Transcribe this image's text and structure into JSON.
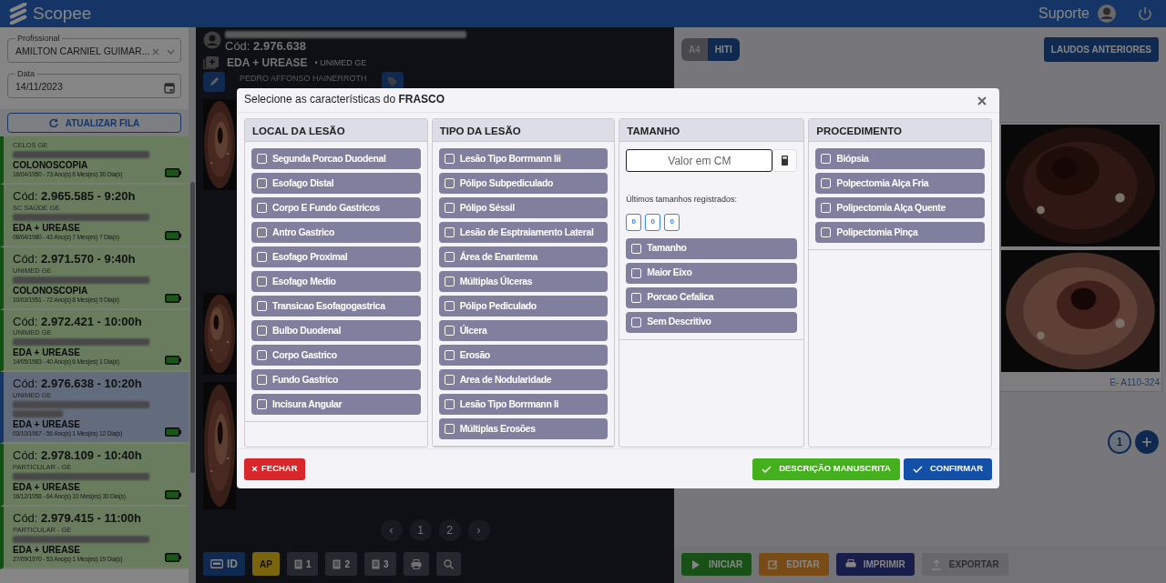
{
  "app": {
    "brand": "Scopee",
    "support": "Suporte"
  },
  "filters": {
    "professional": {
      "label": "Profissional",
      "value": "AMILTON CARNIEL GUIMAR..."
    },
    "date": {
      "label": "Data",
      "value": "14/11/2023"
    }
  },
  "refresh_button": "ATUALIZAR FILA",
  "queue": [
    {
      "insurer": "CELOS GE",
      "exam": "COLONOSCOPIA",
      "birth": "16/04/1950 - 73 Ano(s) 6 Mes(es) 30 Dia(s)",
      "selected": false,
      "long_name": false
    },
    {
      "code": "Cód: **2.965.585 - 9:20h**",
      "insurer": "SC SAÚDE GE",
      "exam": "EDA + UREASE",
      "birth": "08/04/1980 - 43 Ano(s) 7 Mes(es) 7 Dia(s)",
      "selected": false,
      "long_name": false
    },
    {
      "code": "Cód: **2.971.570 - 9:40h**",
      "insurer": "UNIMED GE",
      "exam": "COLONOSCOPIA",
      "birth": "10/03/1951 - 72 Ano(s) 8 Mes(es) 5 Dia(s)",
      "selected": false,
      "long_name": false
    },
    {
      "code": "Cód: **2.972.421 - 10:00h**",
      "insurer": "UNIMED GE",
      "exam": "EDA + UREASE",
      "birth": "14/05/1983 - 40 Ano(s) 6 Mes(es) 1 Dia(s)",
      "selected": false,
      "long_name": false
    },
    {
      "code": "Cód: **2.976.638 - 10:20h**",
      "insurer": "UNIMED GE",
      "exam": "EDA + UREASE",
      "birth": "03/10/1967 - 56 Ano(s) 1 Mes(es) 12 Dia(s)",
      "selected": true,
      "long_name": true
    },
    {
      "code": "Cód: **2.978.109 - 10:40h**",
      "insurer": "PARTICULAR - GE",
      "exam": "EDA + UREASE",
      "birth": "16/12/1958 - 64 Ano(s) 10 Mes(es) 30 Dia(s)",
      "selected": false,
      "long_name": false
    },
    {
      "code": "Cód: **2.979.415 - 11:00h**",
      "insurer": "PARTICULAR - GE",
      "exam": "EDA + UREASE",
      "birth": "27/09/1970 - 53 Ano(s) 1 Mes(es) 19 Dia(s)",
      "selected": false,
      "long_name": false
    }
  ],
  "patient": {
    "code": "Cód: **2.976.638**",
    "exam": "EDA + UREASE",
    "insurer": "• UNIMED GE",
    "doctor": "PEDRO AFFONSO HAINERROTH"
  },
  "pagination": {
    "prev": "‹",
    "pages": [
      "1",
      "2"
    ],
    "next": "›"
  },
  "toolbar": [
    {
      "kind": "id",
      "label": "ID"
    },
    {
      "kind": "ap",
      "label": "AP"
    },
    {
      "kind": "doc",
      "label": "1"
    },
    {
      "kind": "doc",
      "label": "2"
    },
    {
      "kind": "doc",
      "label": "3"
    },
    {
      "kind": "print"
    },
    {
      "kind": "search"
    }
  ],
  "report": {
    "formats": [
      {
        "label": "A4",
        "selected": false
      },
      {
        "label": "HITI",
        "selected": true
      }
    ],
    "previous_button": "LAUDOS ANTERIORES",
    "image_caption": "E- A110-324",
    "page": "1"
  },
  "actions": [
    {
      "kind": "start",
      "label": "INICIAR",
      "disabled": false
    },
    {
      "kind": "edit",
      "label": "EDITAR",
      "disabled": false
    },
    {
      "kind": "print",
      "label": "IMPRIMIR",
      "disabled": false
    },
    {
      "kind": "export",
      "label": "EXPORTAR",
      "disabled": true
    }
  ],
  "modal": {
    "title": "Selecione as características do **FRASCO**",
    "columns": [
      {
        "title": "LOCAL DA LESÃO",
        "options": [
          {
            "label": "Segunda Porcao Duodenal",
            "checked": false
          },
          {
            "label": "Esofago Distal",
            "checked": false
          },
          {
            "label": "Corpo E Fundo Gastricos",
            "checked": false
          },
          {
            "label": "Antro Gastrico",
            "checked": false
          },
          {
            "label": "Esofago Proximal",
            "checked": false
          },
          {
            "label": "Esofago Medio",
            "checked": false
          },
          {
            "label": "Transicao Esofagogastrica",
            "checked": false
          },
          {
            "label": "Bulbo Duodenal",
            "checked": false
          },
          {
            "label": "Corpo Gastrico",
            "checked": false
          },
          {
            "label": "Fundo Gastrico",
            "checked": false
          },
          {
            "label": "Incisura Angular",
            "checked": false
          }
        ]
      },
      {
        "title": "TIPO DA LESÃO",
        "options": [
          {
            "label": "Lesão Tipo Borrmann Iii",
            "checked": false
          },
          {
            "label": "Pólipo Subpediculado",
            "checked": false
          },
          {
            "label": "Pólipo Séssil",
            "checked": false
          },
          {
            "label": "Lesão de Esptraiamento Lateral",
            "checked": false
          },
          {
            "label": "Área de Enantema",
            "checked": false
          },
          {
            "label": "Múltiplas Úlceras",
            "checked": false
          },
          {
            "label": "Pólipo Pediculado",
            "checked": false
          },
          {
            "label": "Úlcera",
            "checked": false
          },
          {
            "label": "Erosão",
            "checked": false
          },
          {
            "label": "Area de Nodularidade",
            "checked": false
          },
          {
            "label": "Lesão Tipo Borrmann Ii",
            "checked": false
          },
          {
            "label": "Múltiplas Erosões",
            "checked": false
          }
        ]
      },
      {
        "title": "TAMANHO",
        "size_input": {
          "placeholder": "Valor em CM"
        },
        "recent_label": "Últimos tamanhos registrados:",
        "recent_sizes": [
          "0",
          "0",
          "0"
        ],
        "options": [
          {
            "label": "Tamanho",
            "checked": false
          },
          {
            "label": "Maior Eixo",
            "checked": false
          },
          {
            "label": "Porcao Cefalica",
            "checked": false
          },
          {
            "label": "Sem Descritivo",
            "checked": false
          }
        ]
      },
      {
        "title": "PROCEDIMENTO",
        "options": [
          {
            "label": "Biópsia",
            "checked": false
          },
          {
            "label": "Polpectomia Alça Fria",
            "checked": false
          },
          {
            "label": "Polipectomia Alça Quente",
            "checked": false
          },
          {
            "label": "Polipectomia Pinça",
            "checked": false
          }
        ]
      }
    ],
    "close_button": "FECHAR",
    "handwritten_button": "DESCRIÇÃO MANUSCRITA",
    "confirm_button": "CONFIRMAR"
  }
}
